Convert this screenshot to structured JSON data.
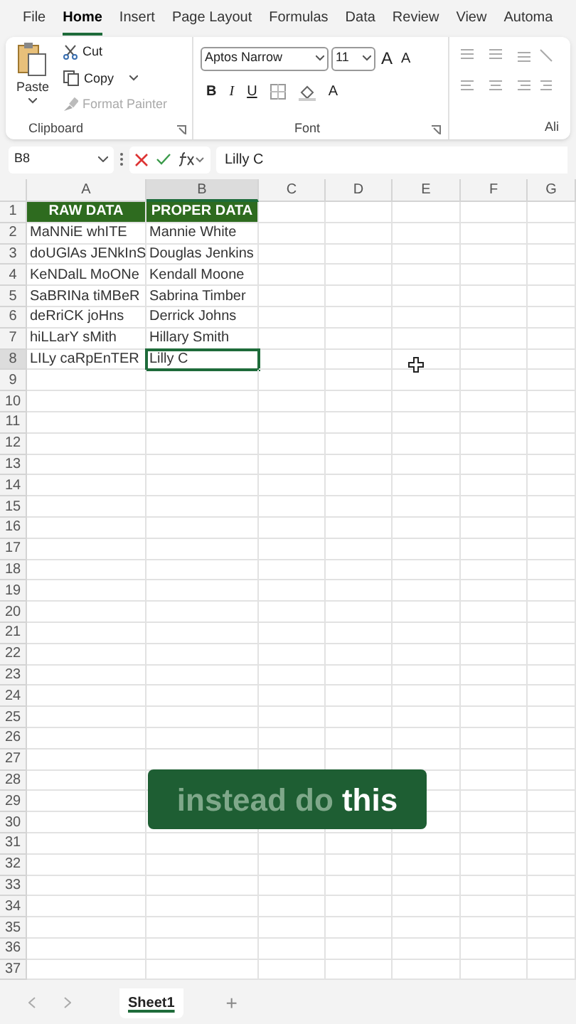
{
  "menu_tabs": [
    {
      "label": "File",
      "selected": false
    },
    {
      "label": "Home",
      "selected": true
    },
    {
      "label": "Insert",
      "selected": false
    },
    {
      "label": "Page Layout",
      "selected": false
    },
    {
      "label": "Formulas",
      "selected": false
    },
    {
      "label": "Data",
      "selected": false
    },
    {
      "label": "Review",
      "selected": false
    },
    {
      "label": "View",
      "selected": false
    },
    {
      "label": "Automa",
      "selected": false
    }
  ],
  "clipboard": {
    "paste": "Paste",
    "cut": "Cut",
    "copy": "Copy",
    "format_painter": {
      "label": "Format Painter",
      "disabled": true
    },
    "group_label": "Clipboard"
  },
  "font": {
    "font_name": "Aptos Narrow",
    "font_size": "11",
    "grow": "A",
    "shrink": "A",
    "bold": "B",
    "italic": "I",
    "underline": "U",
    "font_color": "A",
    "group_label": "Font"
  },
  "alignment": {
    "group_label": "Ali"
  },
  "formula_bar": {
    "name_box": "B8",
    "formula": "Lilly C"
  },
  "columns": [
    {
      "label": "A",
      "selected": false
    },
    {
      "label": "B",
      "selected": true
    },
    {
      "label": "C",
      "selected": false
    },
    {
      "label": "D",
      "selected": false
    },
    {
      "label": "E",
      "selected": false
    },
    {
      "label": "F",
      "selected": false
    },
    {
      "label": "G",
      "selected": false
    }
  ],
  "rows": [
    {
      "number": "1",
      "selected": false,
      "kind": "header",
      "cells": [
        "RAW DATA",
        "PROPER DATA"
      ]
    },
    {
      "number": "2",
      "selected": false,
      "kind": "data",
      "cells": [
        "MaNNiE whITE",
        "Mannie White"
      ]
    },
    {
      "number": "3",
      "selected": false,
      "kind": "data",
      "cells": [
        "doUGlAs JENkInS",
        "Douglas Jenkins"
      ]
    },
    {
      "number": "4",
      "selected": false,
      "kind": "data",
      "cells": [
        "KeNDalL MoONe",
        "Kendall Moone"
      ]
    },
    {
      "number": "5",
      "selected": false,
      "kind": "data",
      "cells": [
        "SaBRINa tiMBeR",
        "Sabrina Timber"
      ]
    },
    {
      "number": "6",
      "selected": false,
      "kind": "data",
      "cells": [
        "deRriCK joHns",
        "Derrick Johns"
      ]
    },
    {
      "number": "7",
      "selected": false,
      "kind": "data",
      "cells": [
        "hiLLarY sMith",
        "Hillary Smith"
      ]
    },
    {
      "number": "8",
      "selected": true,
      "kind": "data",
      "cells": [
        "LILy caRpEnTER",
        "Lilly C"
      ]
    },
    {
      "number": "9",
      "selected": false
    },
    {
      "number": "10",
      "selected": false
    },
    {
      "number": "11",
      "selected": false
    },
    {
      "number": "12",
      "selected": false
    },
    {
      "number": "13",
      "selected": false
    },
    {
      "number": "14",
      "selected": false
    },
    {
      "number": "15",
      "selected": false
    },
    {
      "number": "16",
      "selected": false
    },
    {
      "number": "17",
      "selected": false
    },
    {
      "number": "18",
      "selected": false
    },
    {
      "number": "19",
      "selected": false
    },
    {
      "number": "20",
      "selected": false
    },
    {
      "number": "21",
      "selected": false
    },
    {
      "number": "22",
      "selected": false
    },
    {
      "number": "23",
      "selected": false
    },
    {
      "number": "24",
      "selected": false
    },
    {
      "number": "25",
      "selected": false
    },
    {
      "number": "26",
      "selected": false
    },
    {
      "number": "27",
      "selected": false
    },
    {
      "number": "28",
      "selected": false
    },
    {
      "number": "29",
      "selected": false
    },
    {
      "number": "30",
      "selected": false
    },
    {
      "number": "31",
      "selected": false
    },
    {
      "number": "32",
      "selected": false
    },
    {
      "number": "33",
      "selected": false
    },
    {
      "number": "34",
      "selected": false
    },
    {
      "number": "35",
      "selected": false
    },
    {
      "number": "36",
      "selected": false
    },
    {
      "number": "37",
      "selected": false
    }
  ],
  "caption": [
    {
      "text": "instead do",
      "highlighted": false
    },
    {
      "text": "this",
      "highlighted": true
    }
  ],
  "sheet_tabs": [
    {
      "label": "Sheet1",
      "selected": true
    }
  ],
  "add_sheet": "+"
}
